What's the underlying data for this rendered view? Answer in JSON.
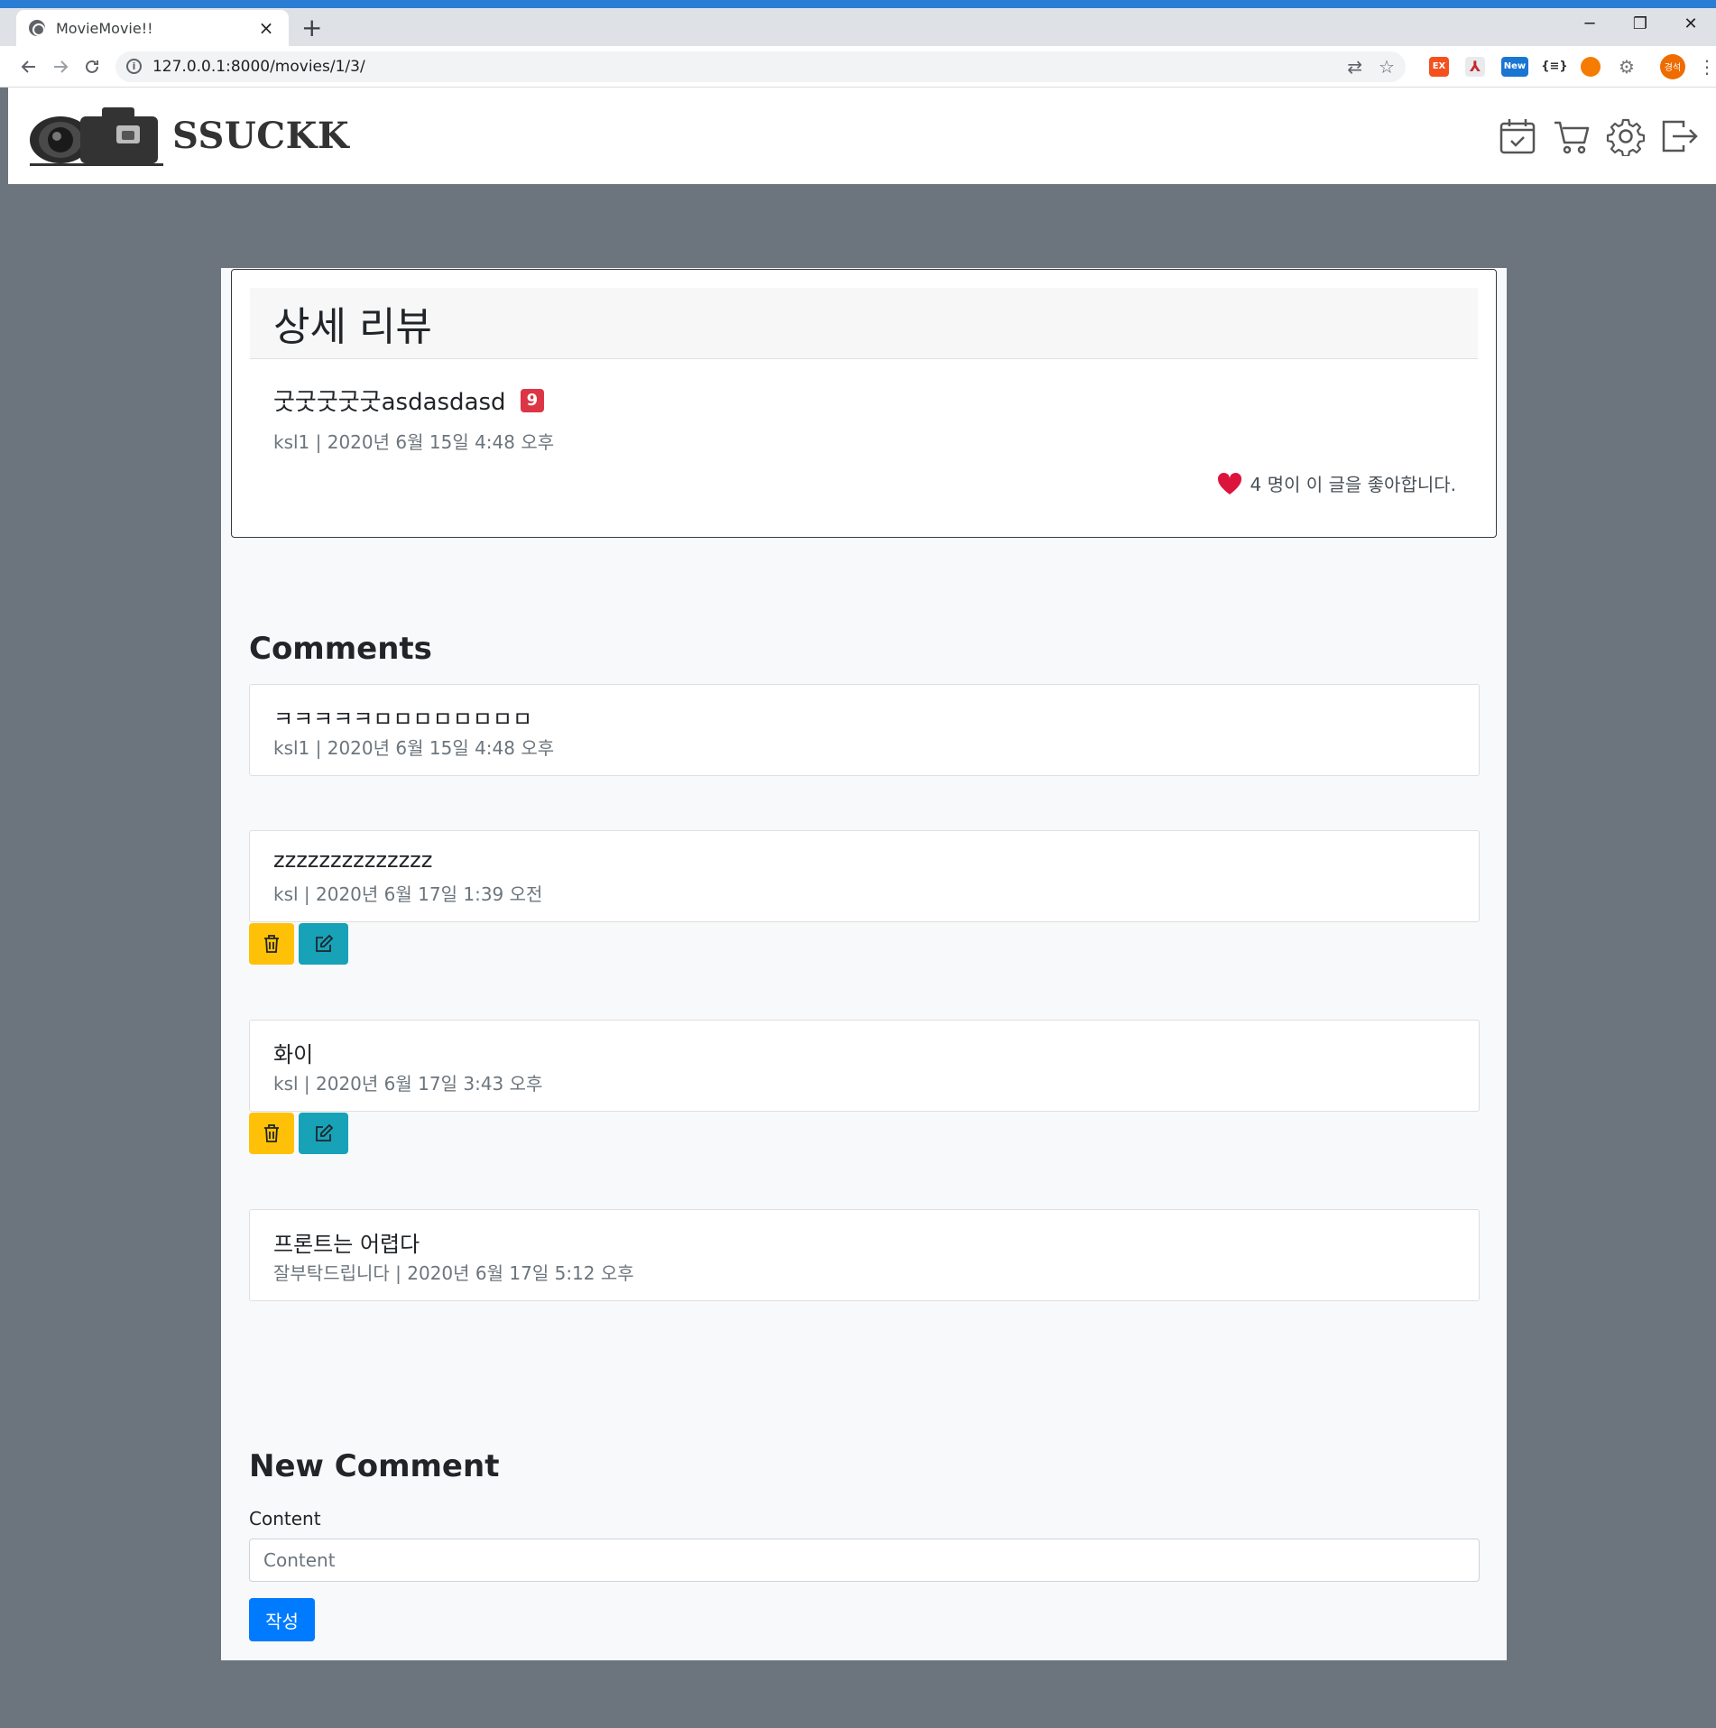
{
  "browser": {
    "tab_title": "MovieMovie!!",
    "tab_close": "×",
    "new_tab": "+",
    "url": "127.0.0.1:8000/movies/1/3/",
    "win_min": "─",
    "win_restore": "❐",
    "win_close": "✕",
    "extensions": [
      "EX",
      "New",
      "{≡}"
    ],
    "profile_label": "경석"
  },
  "site": {
    "brand": "SSUCKK",
    "nav_icons": [
      "calendar-check-icon",
      "cart-icon",
      "gear-icon",
      "logout-icon"
    ]
  },
  "review": {
    "header": "상세 리뷰",
    "title": "굿굿굿굿굿asdasdasd",
    "score": "9",
    "meta": "ksl1 | 2020년 6월 15일 4:48 오후",
    "likes_text": "4 명이 이 글을 좋아합니다.",
    "like_color": "#dc143c"
  },
  "comments_section": {
    "title": "Comments",
    "items": [
      {
        "text": "ㅋㅋㅋㅋㅋㅁㅁㅁㅁㅁㅁㅁㅁ",
        "meta": "ksl1 | 2020년 6월 15일 4:48 오후",
        "editable": false
      },
      {
        "text": "zzzzzzzzzzzzzz",
        "meta": "ksl | 2020년 6월 17일 1:39 오전",
        "editable": true
      },
      {
        "text": "화이",
        "meta": "ksl | 2020년 6월 17일 3:43 오후",
        "editable": true
      },
      {
        "text": "프론트는 어렵다",
        "meta": "잘부탁드립니다 | 2020년 6월 17일 5:12 오후",
        "editable": false
      }
    ]
  },
  "new_comment": {
    "title": "New Comment",
    "label": "Content",
    "placeholder": "Content",
    "submit_label": "작성"
  },
  "colors": {
    "page_bg": "#6c757d",
    "delete_btn": "#ffc107",
    "edit_btn": "#17a2b8",
    "submit_btn": "#007bff",
    "badge": "#dc3545"
  }
}
